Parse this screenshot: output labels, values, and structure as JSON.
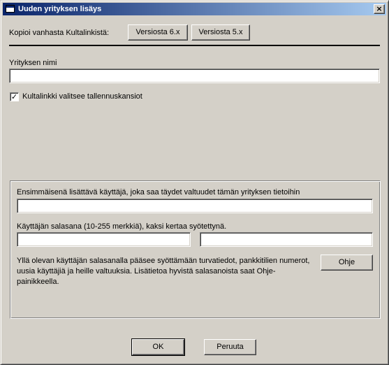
{
  "window": {
    "title": "Uuden yrityksen lisäys",
    "close_glyph": "×"
  },
  "copy_section": {
    "label": "Kopioi vanhasta Kultalinkistä:",
    "button_v6": "Versiosta 6.x",
    "button_v5": "Versiosta 5.x"
  },
  "company": {
    "name_label": "Yrityksen nimi",
    "name_value": ""
  },
  "folders_checkbox": {
    "label": "Kultalinkki valitsee tallennuskansiot",
    "checked": true,
    "check_glyph": "✓"
  },
  "user_group": {
    "first_user_label": "Ensimmäisenä lisättävä käyttäjä, joka saa täydet valtuudet tämän yrityksen tietoihin",
    "first_user_value": "",
    "password_label": "Käyttäjän salasana (10-255 merkkiä), kaksi kertaa syötettynä.",
    "password_value": "",
    "password_confirm_value": "",
    "info_line1": "Yllä olevan käyttäjän salasanalla pääsee syöttämään turvatiedot, pankkitilien numerot,",
    "info_line2": "uusia käyttäjiä ja heille valtuuksia. Lisätietoa hyvistä salasanoista saat Ohje-painikkeella.",
    "help_button": "Ohje"
  },
  "footer": {
    "ok_button": "OK",
    "cancel_button": "Peruuta"
  }
}
